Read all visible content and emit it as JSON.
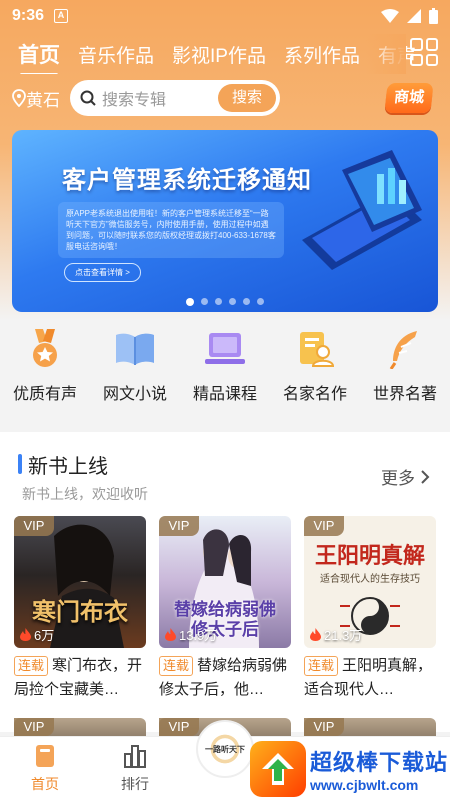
{
  "status": {
    "time": "9:36",
    "app_icon_letter": "A"
  },
  "tabs": [
    "首页",
    "音乐作品",
    "影视IP作品",
    "系列作品",
    "有声"
  ],
  "location": "黄石",
  "search": {
    "placeholder": "搜索专辑",
    "button": "搜索"
  },
  "mall_label": "商城",
  "banner": {
    "title": "客户管理系统迁移通知",
    "body": "原APP老系统退出使用啦！新的客户管理系统迁移至“一路听天下官方”微信服务号，内附使用手册，使用过程中如遇到问题，可以随时联系您的版权经理或拨打400-633-1678客服电话咨询哦！",
    "button": "点击查看详情 >",
    "dot_count": 6,
    "active_dot": 0
  },
  "categories": [
    {
      "label": "优质有声",
      "icon": "medal-icon"
    },
    {
      "label": "网文小说",
      "icon": "book-icon"
    },
    {
      "label": "精品课程",
      "icon": "laptop-icon"
    },
    {
      "label": "名家名作",
      "icon": "author-icon"
    },
    {
      "label": "世界名著",
      "icon": "feather-icon"
    }
  ],
  "section": {
    "title": "新书上线",
    "subtitle": "新书上线，欢迎收听",
    "more": "更多"
  },
  "books": [
    {
      "vip": "VIP",
      "plays": "6万",
      "tag": "连载",
      "title": "寒门布衣，开局捡个宝藏美…",
      "cover_text": "寒门布衣"
    },
    {
      "vip": "VIP",
      "plays": "13.9万",
      "tag": "连载",
      "title": "替嫁给病弱佛修太子后，他…",
      "cover_text": "替嫁给病弱佛修太子后"
    },
    {
      "vip": "VIP",
      "plays": "21.3万",
      "tag": "连载",
      "title": "王阳明真解，适合现代人…",
      "cover_text": "王阳明真解",
      "cover_sub": "适合现代人的生存技巧"
    }
  ],
  "row2_vip": [
    "VIP",
    "VIP",
    "VIP"
  ],
  "nav": [
    {
      "label": "首页",
      "icon": "home-icon",
      "active": true
    },
    {
      "label": "排行",
      "icon": "ranking-icon",
      "active": false
    }
  ],
  "center_disc_text": "一路听天下",
  "watermark": {
    "title": "超级棒下载站",
    "url": "www.cjbwlt.com"
  },
  "colors": {
    "accent": "#f4a458",
    "banner_blue": "#2e7af0",
    "section_bar": "#3b82f6"
  }
}
